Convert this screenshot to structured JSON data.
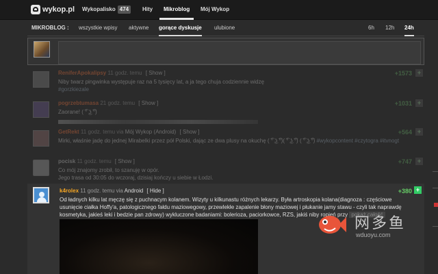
{
  "topnav": {
    "logo_text": "wykop.pl",
    "items": [
      {
        "label": "Wykopalisko",
        "badge": "474"
      },
      {
        "label": "Hity"
      },
      {
        "label": "Mikroblog"
      },
      {
        "label": "Mój Wykop"
      }
    ]
  },
  "subnav": {
    "label": "MIKROBLOG :",
    "tabs": [
      "wszystkie wpisy",
      "aktywne",
      "gorące dyskusje",
      "ulubione"
    ],
    "time_tabs": [
      "6h",
      "12h",
      "24h"
    ]
  },
  "entries": [
    {
      "author": "ReniferApokalipsy",
      "author_color": "#e06c3c",
      "meta": "11 godz. temu",
      "btn": "[ Show ]",
      "body": "Niby twarz pingwinka występuje raz na 5 tysięcy lat, a ja tego chuja codziennie widzę",
      "tag": "#gorzkiezale",
      "score": "+1573"
    },
    {
      "author": "pogrzebtumasa",
      "author_color": "#e06c3c",
      "meta": "21 godz. temu",
      "btn": "[ Show ]",
      "body": "Zaorane! ( ͡° ͜ʖ ͡°)",
      "score": "+1031"
    },
    {
      "author": "GetRekt",
      "author_color": "#e06c3c",
      "meta": "11 godz. temu via",
      "via": "Mój Wykop (Android)",
      "btn": "[ Show ]",
      "body": "Mirki, właśnie jadę do jednej Mirabelki przez pół Polski, dając ze dwa plusy na okuchę ( ͡° ͜ʖ ͡°)( ͡° ͜ʖ ͡°) ( ͡° ͜ʖ ͡°)",
      "tags": "#wykopcontent #czytogra #itvnogt",
      "score": "+564"
    },
    {
      "author": "pocisk",
      "author_color": "#bbbbbb",
      "meta": "11 godz. temu",
      "btn": "[ Show ]",
      "body": "Co mój znajomy zrobił, to szanuję w opór.",
      "body2": "Jego trasa od 30:05 do wczoraj, dzisiaj kończy u siebie w Łodzi.",
      "score": "+747"
    }
  ],
  "active_entry": {
    "author": "k4rolex",
    "meta": "11 godz. temu via",
    "via": "Android",
    "btn": "[ Hide ]",
    "body": "Od ładnych kilku lat męczę się z puchnacym kolanem. Wizyty u kilkunastu różnych lekarzy. Była artroskopia kolana(diagnoza : częściowe usunięcie ciałka Hoffy'a, patologicznego fałdu maziowegowy, przewlekłe zapalenie błony maziowej i płukanie jamy stawu - czyli tak naprawdę kosmetyka, jakieś leki i bedzie pan zdrowy) wykluczone badaniami: bolerioza, paciorkowce, RZS, jakiś niby ropień przy",
    "show_more": "pokaż całość",
    "score": "+380",
    "plus": "+"
  },
  "watermark": {
    "cn": "网多鱼",
    "url": "wduoyu.com"
  },
  "colors": {
    "accent_green": "#66cc66",
    "author_orange": "#f5a623"
  }
}
